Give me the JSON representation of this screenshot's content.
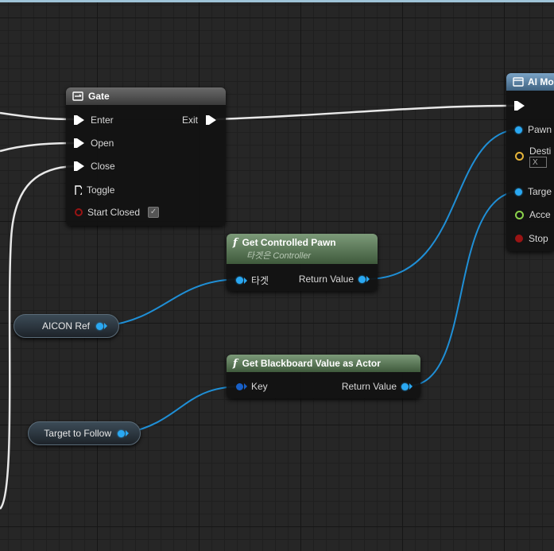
{
  "gate": {
    "title": "Gate",
    "inputs": [
      "Enter",
      "Open",
      "Close",
      "Toggle"
    ],
    "start_closed": "Start Closed",
    "start_closed_checked": true,
    "exit": "Exit"
  },
  "get_pawn": {
    "title": "Get Controlled Pawn",
    "subtitle": "타겟은 Controller",
    "input": "타겟",
    "output": "Return Value"
  },
  "get_bb": {
    "title": "Get Blackboard Value as Actor",
    "input": "Key",
    "output": "Return Value"
  },
  "ai_move": {
    "title": "AI Mo",
    "pins": [
      "Pawn",
      "Desti",
      "Targe",
      "Acce",
      "Stop"
    ],
    "vector_x": "X"
  },
  "vars": {
    "aicon": "AICON Ref",
    "target": "Target to Follow"
  },
  "colors": {
    "exec": "#ffffff",
    "object": "#2aa8f2",
    "vector": "#e7b53a",
    "float": "#8bd24b",
    "bool": "#9a1414"
  },
  "icons": [
    "gate-icon",
    "function-icon",
    "ai-move-icon",
    "checkmark-icon"
  ]
}
